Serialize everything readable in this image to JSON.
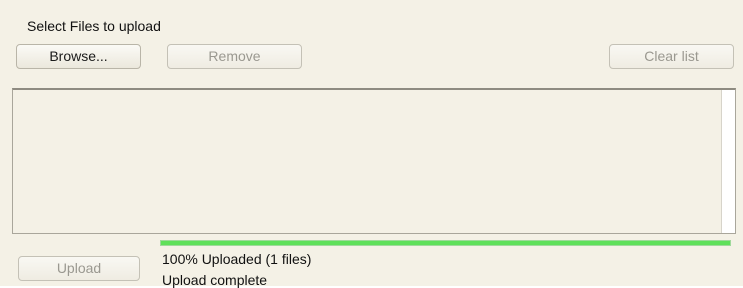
{
  "uploader": {
    "title": "Select Files to upload",
    "buttons": {
      "browse": "Browse...",
      "remove": "Remove",
      "clear_list": "Clear list",
      "upload": "Upload"
    },
    "file_list": [],
    "progress": {
      "percent": 100,
      "summary": "100% Uploaded (1 files)",
      "status": "Upload complete",
      "color": "#5fe05a"
    }
  }
}
